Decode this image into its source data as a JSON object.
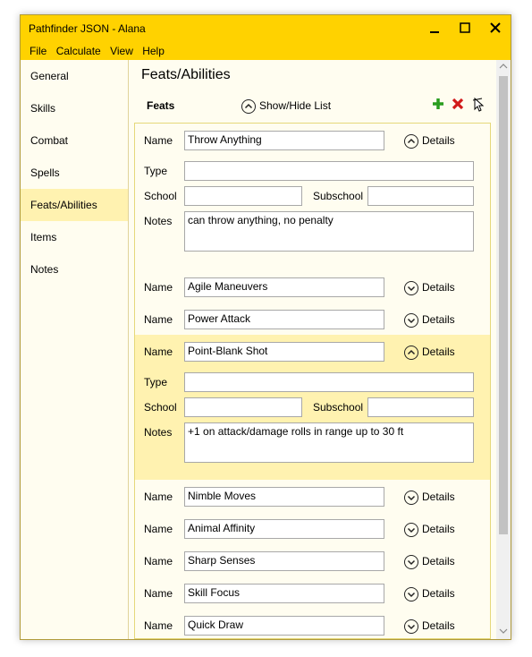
{
  "window": {
    "title": "Pathfinder JSON - Alana",
    "minimize": "▁",
    "maximize": "☐",
    "close": "✕"
  },
  "menu": [
    "File",
    "Calculate",
    "View",
    "Help"
  ],
  "sidebar": {
    "items": [
      "General",
      "Skills",
      "Combat",
      "Spells",
      "Feats/Abilities",
      "Items",
      "Notes"
    ],
    "selected": "Feats/Abilities"
  },
  "page": {
    "title": "Feats/Abilities"
  },
  "toolbar": {
    "section_label": "Feats",
    "showhide_label": "Show/Hide List",
    "add_icon": "plus-icon",
    "remove_icon": "delete-icon",
    "cursor_icon": "cursor-icon"
  },
  "labels": {
    "name": "Name",
    "type": "Type",
    "school": "School",
    "subschool": "Subschool",
    "notes": "Notes",
    "details": "Details"
  },
  "feats": [
    {
      "name": "Throw Anything",
      "expanded": true,
      "type": "",
      "school": "",
      "subschool": "",
      "notes": "can throw anything, no penalty"
    },
    {
      "name": "Agile Maneuvers",
      "expanded": false
    },
    {
      "name": "Power Attack",
      "expanded": false
    },
    {
      "name": "Point-Blank Shot",
      "expanded": true,
      "type": "",
      "school": "",
      "subschool": "",
      "notes": "+1 on attack/damage rolls in range up to 30 ft"
    },
    {
      "name": "Nimble Moves",
      "expanded": false
    },
    {
      "name": "Animal Affinity",
      "expanded": false
    },
    {
      "name": "Sharp Senses",
      "expanded": false
    },
    {
      "name": "Skill Focus",
      "expanded": false
    },
    {
      "name": "Quick Draw",
      "expanded": false
    }
  ],
  "colors": {
    "titlebar": "#ffd200",
    "selected": "#fff2b0",
    "add": "#2a9d1f",
    "remove": "#d11a1a"
  }
}
